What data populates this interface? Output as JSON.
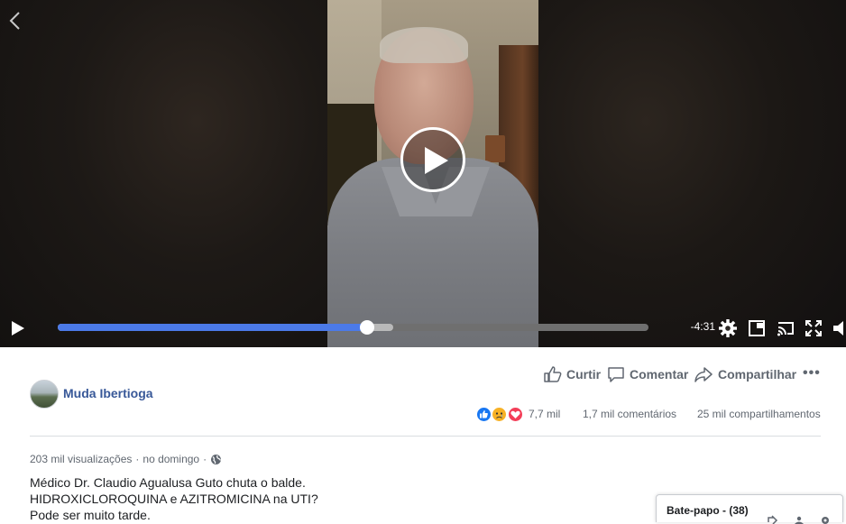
{
  "video": {
    "time_remaining": "-4:31",
    "progress_played": 0.523,
    "progress_buffered": 0.568
  },
  "post": {
    "actions": {
      "like_label": "Curtir",
      "comment_label": "Comentar",
      "share_label": "Compartilhar"
    },
    "page_name": "Muda Ibertioga",
    "reactions": {
      "types": [
        "like",
        "sad",
        "love"
      ],
      "count": "7,7 mil"
    },
    "comments_count": "1,7 mil comentários",
    "shares_count": "25 mil compartilhamentos",
    "views": "203 mil visualizações",
    "separator": "·",
    "posted_time": "no domingo",
    "description_lines": [
      "Médico Dr. Claudio Agualusa Guto chuta o balde.",
      "HIDROXICLOROQUINA e AZITROMICINA na UTI?",
      "Pode ser muito tarde."
    ]
  },
  "chat": {
    "label": "Bate-papo - (38)"
  },
  "colors": {
    "progress_fill": "#4b7ae8",
    "link_blue": "#385898",
    "secondary_text": "#606770"
  }
}
